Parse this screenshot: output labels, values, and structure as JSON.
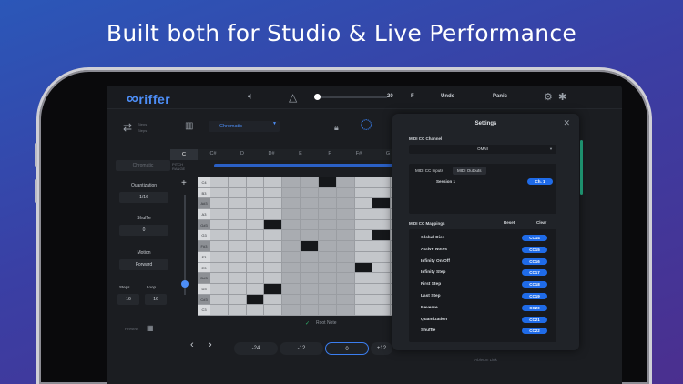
{
  "headline": "Built both for Studio & Live Performance",
  "app": {
    "logo_symbol": "∞",
    "logo_text": "riffer",
    "topbar": {
      "volume_value": "20",
      "f_label": "F",
      "undo": "Undo",
      "panic": "Panic"
    },
    "left_panel": {
      "steps_top": "Steps",
      "steps_bottom": "Steps",
      "section_label": "Chromatic",
      "quantization_label": "Quantization",
      "quantization_value": "1/16",
      "shuffle_label": "Shuffle",
      "shuffle_value": "0",
      "motion_label": "Motion",
      "motion_value": "Forward",
      "steps_label": "Steps",
      "loop_label": "Loop",
      "steps_value": "16",
      "loop_value": "16",
      "presets_label": "Presets"
    },
    "scale_select": "Chromatic",
    "notes": [
      "C",
      "C#",
      "D",
      "D#",
      "E",
      "F",
      "F#",
      "G"
    ],
    "pitch_label": "PITCH RANGE",
    "grid_rows": [
      "C4",
      "B3",
      "A#3",
      "A3",
      "G#3",
      "G3",
      "F#3",
      "F3",
      "E3",
      "D#3",
      "D3",
      "C#3",
      "C3"
    ],
    "grid_active": [
      [
        0,
        6
      ],
      [
        2,
        9
      ],
      [
        4,
        3
      ],
      [
        5,
        9
      ],
      [
        6,
        5
      ],
      [
        8,
        8
      ],
      [
        10,
        3
      ],
      [
        11,
        2
      ]
    ],
    "root_note_label": "Root Note",
    "steps": [
      "-24",
      "-12",
      "0",
      "+12"
    ]
  },
  "settings": {
    "title": "Settings",
    "midi_cc_channel_label": "MIDI CC Channel",
    "channel_value": "OMNI",
    "tabs": [
      "MIDI CC Inputs",
      "MIDI Outputs"
    ],
    "session": "Session 1",
    "session_channel": "Ch. 1",
    "mappings_label": "MIDI CC Mappings",
    "reset": "Reset",
    "clear": "Clear",
    "mappings": [
      {
        "name": "Global Dice",
        "cc": "CC14"
      },
      {
        "name": "Active Notes",
        "cc": "CC15"
      },
      {
        "name": "Infinity On/Off",
        "cc": "CC16"
      },
      {
        "name": "Infinity Step",
        "cc": "CC17"
      },
      {
        "name": "First Step",
        "cc": "CC18"
      },
      {
        "name": "Last Step",
        "cc": "CC19"
      },
      {
        "name": "Reverse",
        "cc": "CC20"
      },
      {
        "name": "Quantization",
        "cc": "CC21"
      },
      {
        "name": "Shuffle",
        "cc": "CC22"
      }
    ],
    "footer": "Ableton Link"
  },
  "colors": {
    "accent": "#1f6be8",
    "grid_active": "#15171a",
    "grid_light": "#c3c6ca",
    "grid_dark": "#a9acb1"
  }
}
